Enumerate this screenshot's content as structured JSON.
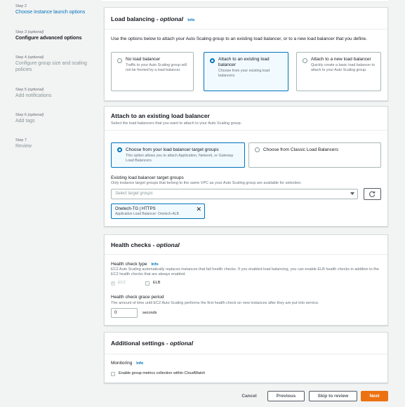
{
  "sidebar": {
    "steps": [
      {
        "label": "Step 2",
        "title": "Choose instance launch options"
      },
      {
        "label": "Step 3",
        "optional": "(optional)",
        "title": "Configure advanced options"
      },
      {
        "label": "Step 4",
        "optional": "(optional)",
        "title": "Configure group size and scaling policies"
      },
      {
        "label": "Step 5",
        "optional": "(optional)",
        "title": "Add notifications"
      },
      {
        "label": "Step 6",
        "optional": "(optional)",
        "title": "Add tags"
      },
      {
        "label": "Step 7",
        "title": "Review"
      }
    ]
  },
  "load_balancing": {
    "title": "Load balancing",
    "title_optional": "- optional",
    "info": "Info",
    "description": "Use the options below to attach your Auto Scaling group to an existing load balancer, or to a new load balancer that you define.",
    "options": [
      {
        "title": "No load balancer",
        "desc": "Traffic to your Auto Scaling group will not be fronted by a load balancer."
      },
      {
        "title": "Attach to an existing load balancer",
        "desc": "Choose from your existing load balancers.",
        "selected": true
      },
      {
        "title": "Attach to a new load balancer",
        "desc": "Quickly create a basic load balancer to attach to your Auto Scaling group."
      }
    ]
  },
  "attach": {
    "title": "Attach to an existing load balancer",
    "subtitle": "Select the load balancers that you want to attach to your Auto Scaling group.",
    "options": [
      {
        "title": "Choose from your load balancer target groups",
        "desc": "This option allows you to attach Application, Network, or Gateway Load Balancers.",
        "selected": true
      },
      {
        "title": "Choose from Classic Load Balancers",
        "desc": ""
      }
    ],
    "target_groups_label": "Existing load balancer target groups",
    "target_groups_hint": "Only instance target groups that belong to the same VPC as your Auto Scaling group are available for selection.",
    "select_placeholder": "Select target groups",
    "token": {
      "title": "Onetech-TG | HTTPS",
      "desc": "Application Load Balancer: Onetech-ALB"
    }
  },
  "health": {
    "title": "Health checks",
    "title_optional": "- optional",
    "type_label": "Health check type",
    "info": "Info",
    "type_desc": "EC2 Auto Scaling automatically replaces instances that fail health checks. If you enabled load balancing, you can enable ELB health checks in addition to the EC2 health checks that are always enabled.",
    "ec2_label": "EC2",
    "elb_label": "ELB",
    "grace_label": "Health check grace period",
    "grace_desc": "The amount of time until EC2 Auto Scaling performs the first health check on new instances after they are put into service.",
    "grace_value": "0",
    "grace_unit": "seconds"
  },
  "additional": {
    "title": "Additional settings",
    "title_optional": "- optional",
    "monitoring_label": "Monitoring",
    "info": "Info",
    "metrics_label": "Enable group metrics collection within CloudWatch"
  },
  "footer": {
    "cancel": "Cancel",
    "previous": "Previous",
    "skip": "Skip to review",
    "next": "Next"
  },
  "colors": {
    "accent": "#0073bb",
    "primary_button": "#ec7211"
  }
}
